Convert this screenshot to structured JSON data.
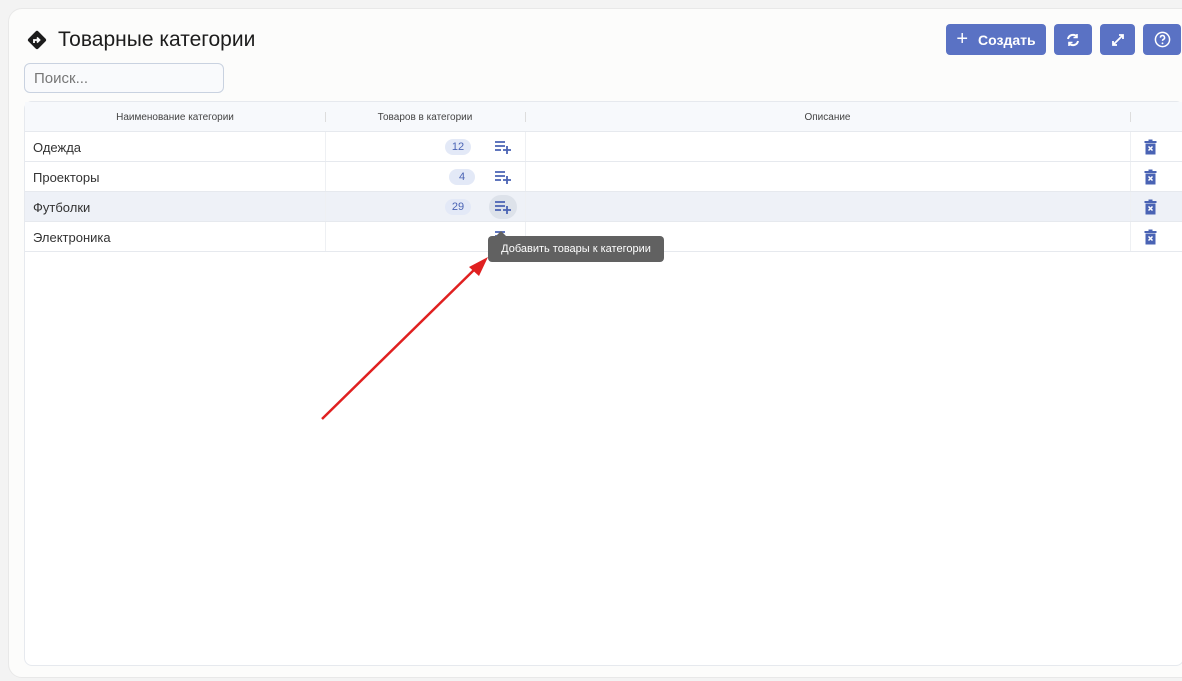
{
  "header": {
    "title": "Товарные категории",
    "icon": "diamond-turn-right-icon"
  },
  "search": {
    "placeholder": "Поиск..."
  },
  "toolbar": {
    "create_label": "Создать",
    "refresh": "refresh-icon",
    "expand": "expand-icon",
    "help": "help-icon"
  },
  "table": {
    "columns": [
      "Наименование категории",
      "Товаров в категории",
      "Описание",
      ""
    ],
    "rows": [
      {
        "name": "Одежда",
        "count": "12",
        "description": ""
      },
      {
        "name": "Проекторы",
        "count": "4",
        "description": ""
      },
      {
        "name": "Футболки",
        "count": "29",
        "description": ""
      },
      {
        "name": "Электроника",
        "count": null,
        "description": ""
      }
    ]
  },
  "tooltip": "Добавить товары к категории",
  "colors": {
    "accent": "#5a72c4",
    "annotation_arrow": "#e02020"
  }
}
